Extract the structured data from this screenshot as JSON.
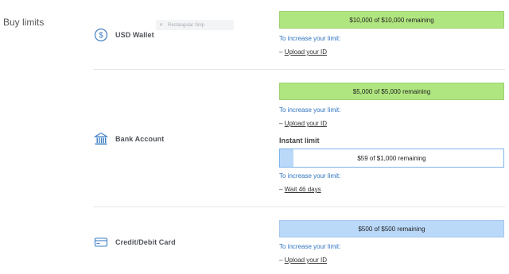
{
  "section_title": "Buy limits",
  "tooltip": {
    "icon": "close-icon",
    "label": "Rectangular Snip"
  },
  "methods": [
    {
      "name": "USD Wallet",
      "icon": "dollar-circle-icon",
      "limit_text": "$10,000 of $10,000 remaining",
      "hint": "To increase your limit:",
      "action_prefix": "– ",
      "action_link": "Upload your ID"
    },
    {
      "name": "Bank Account",
      "icon": "bank-icon",
      "limit_text": "$5,000 of $5,000 remaining",
      "hint": "To increase your limit:",
      "action_prefix": "– ",
      "action_link": "Upload your ID",
      "instant": {
        "title": "Instant limit",
        "limit_text": "$59 of $1,000 remaining",
        "remaining_fraction": 0.059,
        "hint": "To increase your limit:",
        "action_prefix": "– ",
        "action_link": "Wait 46 days"
      }
    },
    {
      "name": "Credit/Debit Card",
      "icon": "credit-card-icon",
      "limit_text": "$500 of $500 remaining",
      "hint": "To increase your limit:",
      "action_prefix": "– ",
      "action_link": "Upload your ID"
    }
  ],
  "colors": {
    "green_bar": "#b0e680",
    "blue_bar": "#bad9f9",
    "hint_text": "#2f74c0",
    "icon_blue": "#3f7fc4"
  }
}
